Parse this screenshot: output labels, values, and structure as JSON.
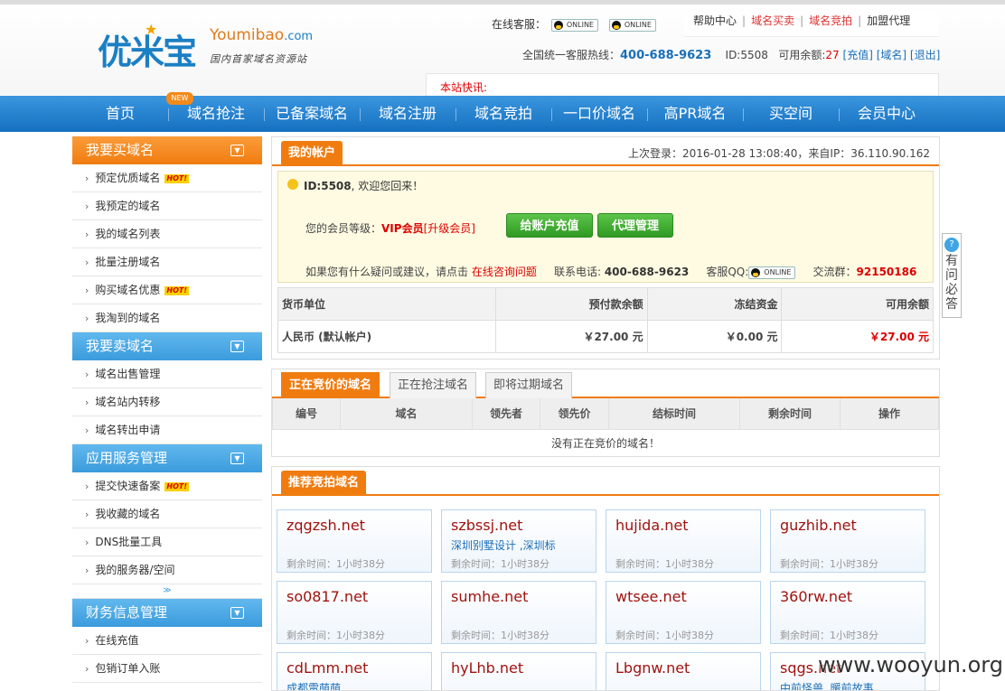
{
  "header": {
    "logo_cn": "优米宝",
    "logo_en": "Youmibao",
    "logo_dotcom": ".com",
    "logo_sub": "国内首家域名资源站",
    "kefu_label": "在线客服：",
    "online_badge": "ONLINE",
    "links": [
      "帮助中心",
      "域名买卖",
      "域名竞拍",
      "加盟代理"
    ],
    "hotline_label": "全国统一客服热线：",
    "hotline": "400-688-9623",
    "id_text": "ID:5508",
    "balance_label": "可用余额:",
    "balance": "27",
    "recharge": "[充值]",
    "domain_link": "[域名]",
    "logout": "[退出]",
    "news_label": "本站快讯:"
  },
  "nav": {
    "items": [
      "首页",
      "域名抢注",
      "已备案域名",
      "域名注册",
      "域名竞拍",
      "一口价域名",
      "高PR域名",
      "买空间",
      "会员中心"
    ],
    "badge": "NEW"
  },
  "sidebar": {
    "sections": [
      {
        "title": "我要买域名",
        "items": [
          "预定优质域名",
          "我预定的域名",
          "我的域名列表",
          "批量注册域名",
          "购买域名优惠",
          "我淘到的域名"
        ]
      },
      {
        "title": "我要卖域名",
        "items": [
          "域名出售管理",
          "域名站内转移",
          "域名转出申请"
        ]
      },
      {
        "title": "应用服务管理",
        "items": [
          "提交快速备案",
          "我收藏的域名",
          "DNS批量工具",
          "我的服务器/空间"
        ]
      },
      {
        "title": "财务信息管理",
        "items": [
          "在线充值",
          "包销订单入账"
        ]
      }
    ],
    "hot_badge": "HOT!",
    "more": "≫"
  },
  "account": {
    "title": "我的帐户",
    "last_login": "上次登录：2016-01-28 13:08:40，来自IP：36.110.90.162",
    "welcome_id": "ID:5508",
    "welcome_text": ", 欢迎您回来！",
    "level_label": "您的会员等级：",
    "level": "VIP会员",
    "upgrade": "[升级会员]",
    "recharge_btn": "给账户充值",
    "agent_btn": "代理管理",
    "feedback_prefix": "如果您有什么疑问或建议，请点击",
    "feedback_link": "在线咨询问题",
    "phone_label": "联系电话:",
    "phone": "400-688-9623",
    "qq_label": "客服QQ:",
    "group_label": "交流群：",
    "group": "92150186"
  },
  "funds": {
    "headers": [
      "货币单位",
      "预付款余额",
      "冻结资金",
      "可用余额"
    ],
    "row": [
      "人民币 (默认帐户)",
      "￥27.00 元",
      "￥0.00 元",
      "￥27.00 元"
    ]
  },
  "bidding": {
    "tabs": [
      "正在竞价的域名",
      "正在抢注域名",
      "即将过期域名"
    ],
    "headers": [
      "编号",
      "域名",
      "领先者",
      "领先价",
      "结标时间",
      "剩余时间",
      "操作"
    ],
    "empty": "没有正在竞价的域名！"
  },
  "recommend": {
    "title": "推荐竞拍域名",
    "time_text": "剩余时间：1小时38分",
    "domains": [
      {
        "name": "zqgzsh.net",
        "desc": ""
      },
      {
        "name": "szbssj.net",
        "desc": "深圳别墅设计 ,深圳标"
      },
      {
        "name": "hujida.net",
        "desc": ""
      },
      {
        "name": "guzhib.net",
        "desc": ""
      },
      {
        "name": "so0817.net",
        "desc": ""
      },
      {
        "name": "sumhe.net",
        "desc": ""
      },
      {
        "name": "wtsee.net",
        "desc": ""
      },
      {
        "name": "360rw.net",
        "desc": ""
      },
      {
        "name": "cdLmm.net",
        "desc": "成都雷萌萌"
      },
      {
        "name": "hyLhb.net",
        "desc": ""
      },
      {
        "name": "Lbgnw.net",
        "desc": ""
      },
      {
        "name": "sqgs.net",
        "desc": "中前怪兽 ,暖前故事"
      }
    ]
  },
  "faq": [
    "有",
    "问",
    "必",
    "答"
  ],
  "watermark": "www.wooyun.org"
}
